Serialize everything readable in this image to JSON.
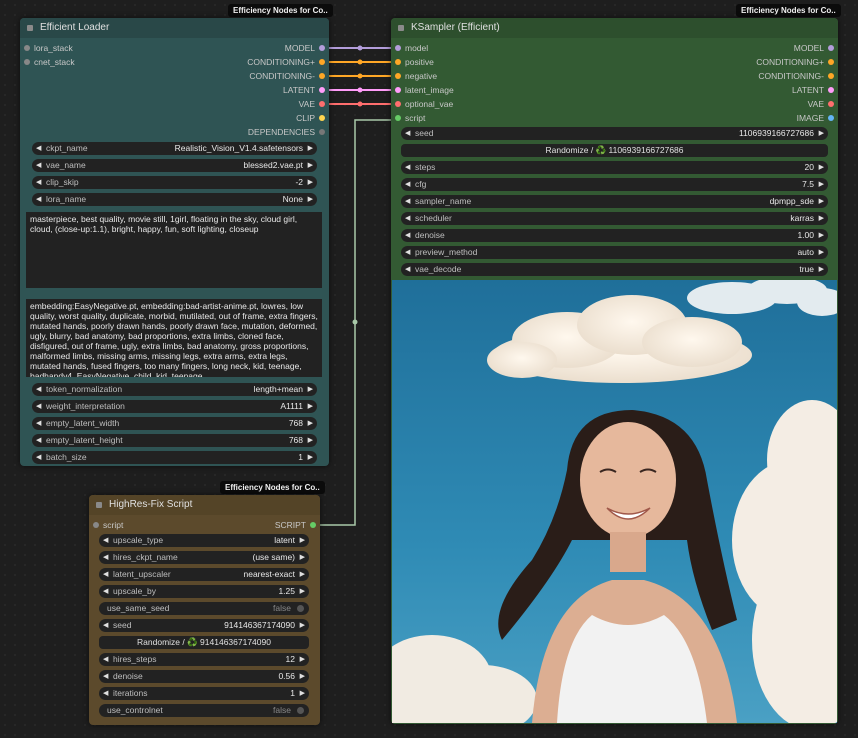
{
  "colors": {
    "model": "#b39ddb",
    "conditioning": "#ffa726",
    "latent": "#ff9cf9",
    "vae": "#ff6e6e",
    "clip": "#ffd54f",
    "script": "#66cc66",
    "image": "#64b5f6"
  },
  "loader": {
    "badge": "Efficiency Nodes for Co..",
    "title": "Efficient Loader",
    "inputs": [
      "lora_stack",
      "cnet_stack"
    ],
    "outputs": [
      "MODEL",
      "CONDITIONING+",
      "CONDITIONING-",
      "LATENT",
      "VAE",
      "CLIP",
      "DEPENDENCIES"
    ],
    "widgets": [
      {
        "label": "ckpt_name",
        "value": "Realistic_Vision_V1.4.safetensors"
      },
      {
        "label": "vae_name",
        "value": "blessed2.vae.pt"
      },
      {
        "label": "clip_skip",
        "value": "-2"
      },
      {
        "label": "lora_name",
        "value": "None"
      }
    ],
    "positive": "masterpiece, best quality, movie still, 1girl, floating in the sky, cloud girl, cloud, (close-up:1.1), bright, happy, fun, soft lighting, closeup",
    "negative": "embedding:EasyNegative.pt, embedding:bad-artist-anime.pt, lowres, low quality, worst quality, duplicate, morbid, mutilated, out of frame, extra fingers, mutated hands, poorly drawn hands, poorly drawn face, mutation, deformed, ugly, blurry, bad anatomy, bad proportions, extra limbs, cloned face, disfigured, out of frame, ugly, extra limbs, bad anatomy, gross proportions, malformed limbs, missing arms, missing legs, extra arms, extra legs, mutated hands, fused fingers, too many fingers, long neck, kid, teenage, badhandv4, EasyNegative, child, kid, teenage",
    "widgets2": [
      {
        "label": "token_normalization",
        "value": "length+mean"
      },
      {
        "label": "weight_interpretation",
        "value": "A1111"
      },
      {
        "label": "empty_latent_width",
        "value": "768"
      },
      {
        "label": "empty_latent_height",
        "value": "768"
      },
      {
        "label": "batch_size",
        "value": "1"
      }
    ]
  },
  "ksampler": {
    "badge": "Efficiency Nodes for Co..",
    "title": "KSampler (Efficient)",
    "inputs": [
      "model",
      "positive",
      "negative",
      "latent_image",
      "optional_vae",
      "script"
    ],
    "outputs": [
      "MODEL",
      "CONDITIONING+",
      "CONDITIONING-",
      "LATENT",
      "VAE",
      "IMAGE"
    ],
    "seed": {
      "label": "seed",
      "value": "1106939166727686"
    },
    "randomize": "Randomize / ♻️ 1106939166727686",
    "widgets": [
      {
        "label": "steps",
        "value": "20"
      },
      {
        "label": "cfg",
        "value": "7.5"
      },
      {
        "label": "sampler_name",
        "value": "dpmpp_sde"
      },
      {
        "label": "scheduler",
        "value": "karras"
      },
      {
        "label": "denoise",
        "value": "1.00"
      },
      {
        "label": "preview_method",
        "value": "auto"
      },
      {
        "label": "vae_decode",
        "value": "true"
      }
    ]
  },
  "hires": {
    "badge": "Efficiency Nodes for Co..",
    "title": "HighRes-Fix Script",
    "input": "script",
    "output": "SCRIPT",
    "widgets": [
      {
        "label": "upscale_type",
        "value": "latent"
      },
      {
        "label": "hires_ckpt_name",
        "value": "(use same)"
      },
      {
        "label": "latent_upscaler",
        "value": "nearest-exact"
      },
      {
        "label": "upscale_by",
        "value": "1.25"
      }
    ],
    "use_same_seed": {
      "label": "use_same_seed",
      "value": "false"
    },
    "seed": {
      "label": "seed",
      "value": "914146367174090"
    },
    "randomize": "Randomize / ♻️ 914146367174090",
    "widgets2": [
      {
        "label": "hires_steps",
        "value": "12"
      },
      {
        "label": "denoise",
        "value": "0.56"
      },
      {
        "label": "iterations",
        "value": "1"
      }
    ],
    "use_controlnet": {
      "label": "use_controlnet",
      "value": "false"
    }
  }
}
